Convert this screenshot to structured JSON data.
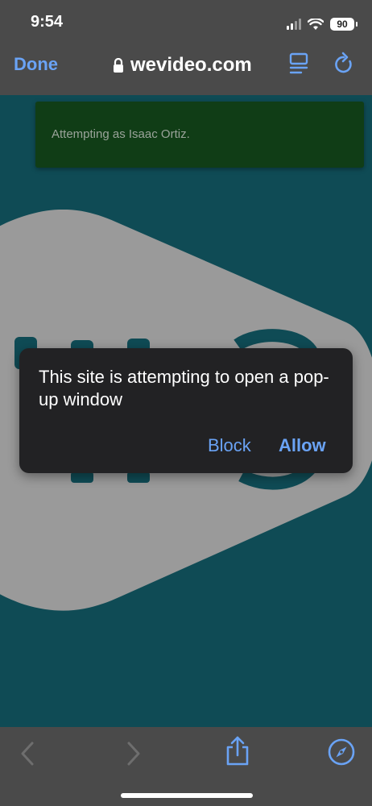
{
  "status_bar": {
    "time": "9:54",
    "battery": "90"
  },
  "safari": {
    "done_label": "Done",
    "address": "wevideo.com"
  },
  "toast": {
    "message": "Attempting as Isaac Ortiz."
  },
  "popup": {
    "message": "This site is attempting to open a pop-up window",
    "block_label": "Block",
    "allow_label": "Allow"
  },
  "colors": {
    "accent": "#6aa3f5",
    "page_background": "#0f4b55",
    "toast_background": "#103d16",
    "dialog_background": "#222224"
  },
  "icons": [
    "lock-icon",
    "reader-icon",
    "reload-icon",
    "back-icon",
    "forward-icon",
    "share-icon",
    "compass-icon"
  ]
}
